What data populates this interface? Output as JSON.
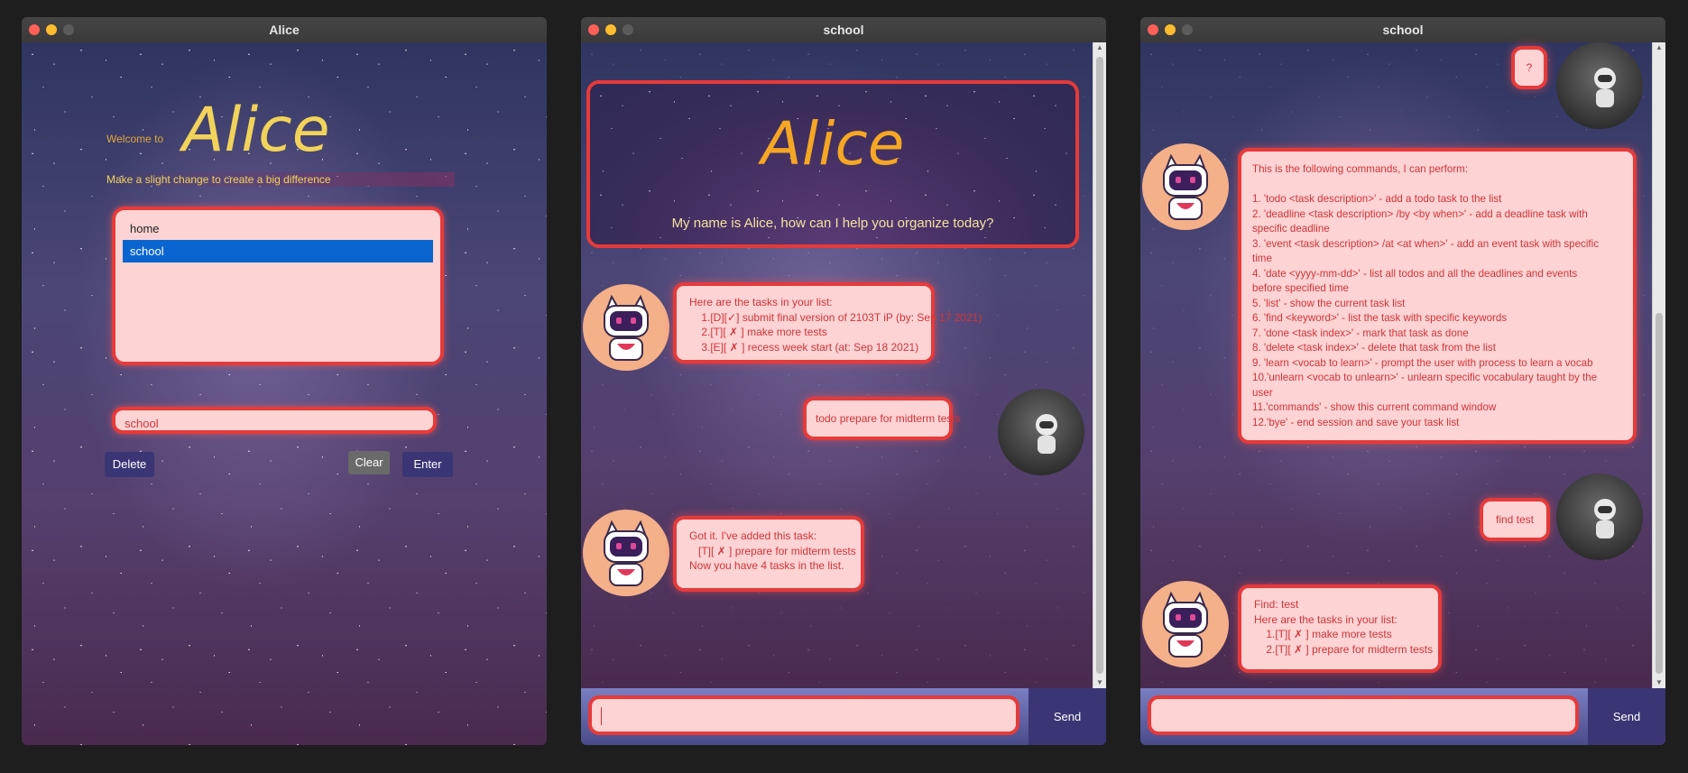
{
  "window1": {
    "title": "Alice",
    "welcome_small": "Welcome to",
    "app_name": "Alice",
    "tagline": "Make a slight change to create a big difference",
    "lists": [
      "home",
      "school"
    ],
    "selected_list": "school",
    "field_value": "school",
    "buttons": {
      "delete": "Delete",
      "clear": "Clear",
      "enter": "Enter"
    }
  },
  "window2": {
    "title": "school",
    "app_name": "Alice",
    "intro": "My name is Alice, how can I help you organize today?",
    "messages": [
      {
        "from": "bot",
        "text": "Here are the tasks in your list:\n    1.[D][✓] submit final version of 2103T iP (by: Sep 17 2021)\n    2.[T][ ✗ ] make more tests\n    3.[E][ ✗ ] recess week start (at: Sep 18 2021)"
      },
      {
        "from": "user",
        "text": "todo prepare for midterm tests"
      },
      {
        "from": "bot",
        "text": "Got it. I've added this task:\n   [T][ ✗ ] prepare for midterm tests\nNow you have 4 tasks in the list."
      }
    ],
    "input_value": "",
    "send_label": "Send"
  },
  "window3": {
    "title": "school",
    "messages": [
      {
        "from": "user",
        "text": "?"
      },
      {
        "from": "bot",
        "text": "This is the following commands, I can perform:\n\n1. 'todo <task description>' - add a todo task to the list\n2. 'deadline <task description> /by <by when>' - add a deadline task with\nspecific deadline\n3. 'event <task description> /at <at when>' - add an event task with specific\ntime\n4. 'date <yyyy-mm-dd>' - list all todos and all the deadlines and events\nbefore specified time\n5. 'list' - show the current task list\n6. 'find <keyword>' - list the task with specific keywords\n7. 'done <task index>' - mark that task as done\n8. 'delete <task index>' - delete that task from the list\n9. 'learn <vocab to learn>' - prompt the user with process to learn a vocab\n10.'unlearn <vocab to unlearn>' - unlearn specific vocabulary taught by the\nuser\n11.'commands' - show this current command window\n12.'bye' - end session and save your task list"
      },
      {
        "from": "user",
        "text": "find test"
      },
      {
        "from": "bot",
        "text": "Find: test\nHere are the tasks in your list:\n    1.[T][ ✗ ] make more tests\n    2.[T][ ✗ ] prepare for midterm tests"
      }
    ],
    "input_value": "",
    "send_label": "Send"
  },
  "colors": {
    "bubble_bg": "#fdd3d3",
    "bubble_border": "#e63a3a",
    "text_red": "#d2343a",
    "title_yellow": "#f2d35a",
    "title_orange": "#f5a623",
    "selected_blue": "#0a64d0",
    "button_purple": "#3a3575"
  }
}
